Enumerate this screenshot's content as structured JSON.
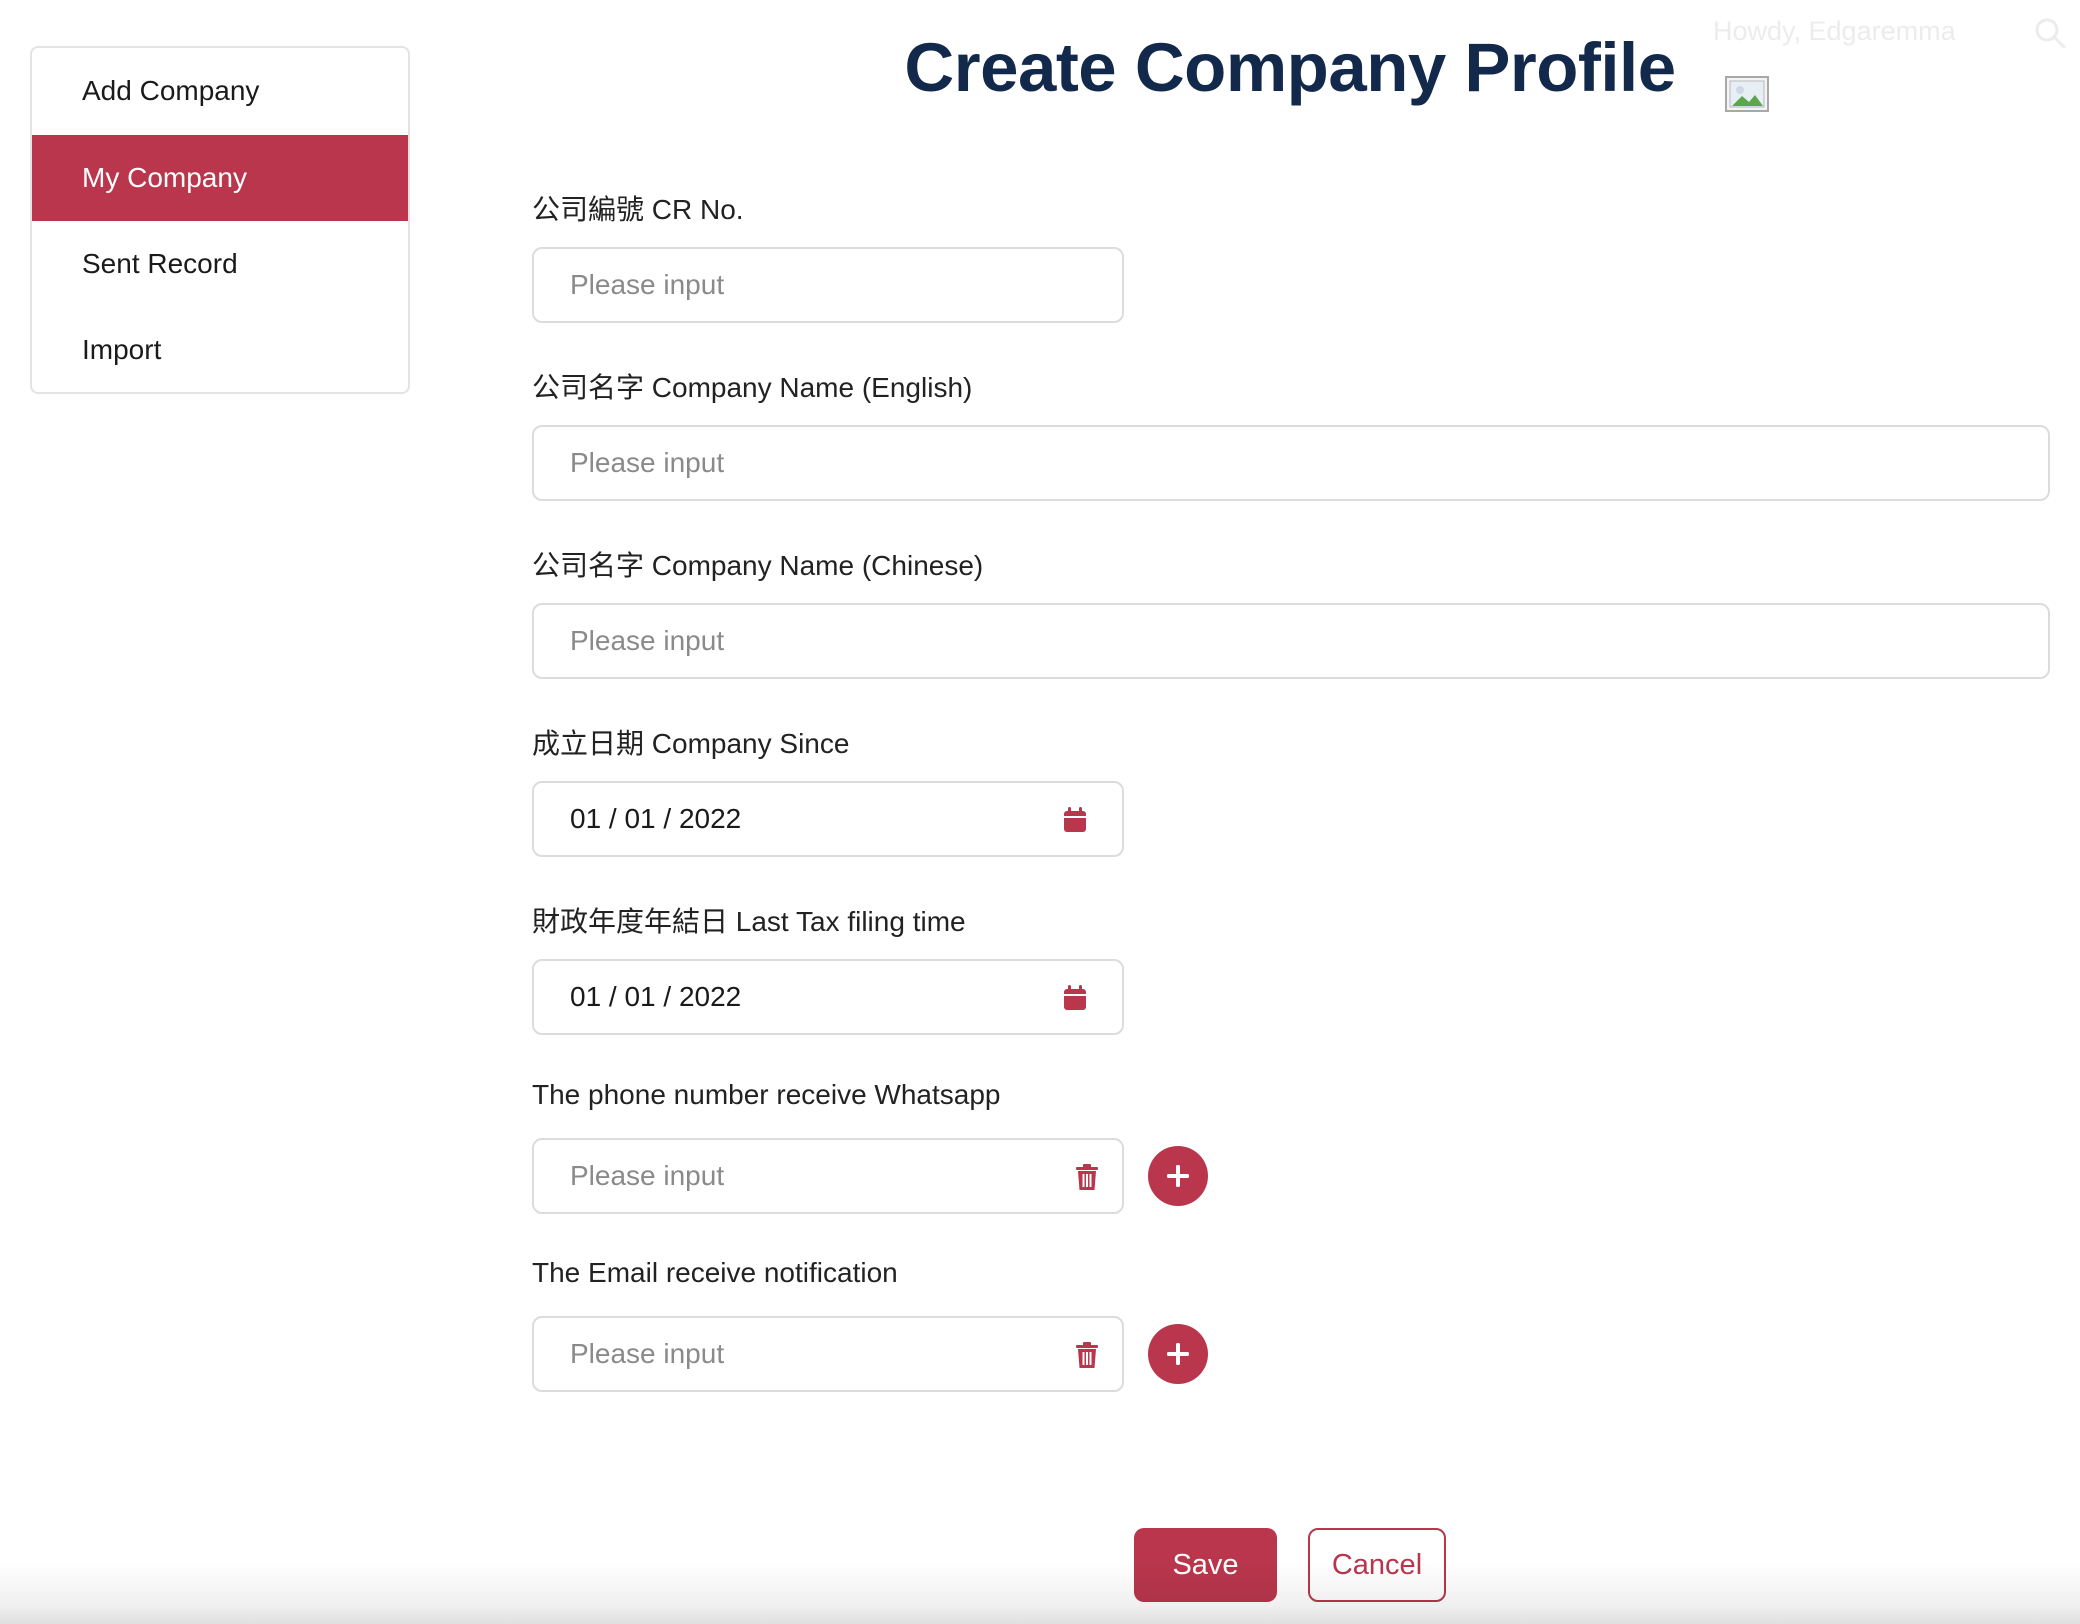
{
  "header": {
    "greeting": "Howdy, Edgaremma",
    "search_icon": "search-icon",
    "avatar_image": "broken-image-icon"
  },
  "sidebar": {
    "items": [
      {
        "label": "Add Company",
        "active": false
      },
      {
        "label": "My Company",
        "active": true
      },
      {
        "label": "Sent Record",
        "active": false
      },
      {
        "label": "Import",
        "active": false
      }
    ]
  },
  "page": {
    "title": "Create Company Profile"
  },
  "form": {
    "cr_no": {
      "label": "公司編號 CR No.",
      "placeholder": "Please input"
    },
    "name_en": {
      "label": "公司名字 Company Name (English)",
      "placeholder": "Please input"
    },
    "name_zh": {
      "label": "公司名字 Company Name (Chinese)",
      "placeholder": "Please input"
    },
    "since": {
      "label": "成立日期 Company Since",
      "value": "01 / 01 / 2022",
      "icon": "calendar-icon"
    },
    "tax": {
      "label": "財政年度年結日 Last Tax filing time",
      "value": "01 / 01 / 2022",
      "icon": "calendar-icon"
    },
    "phone": {
      "label": "The phone number receive Whatsapp",
      "placeholder": "Please input",
      "icon": "trash-icon"
    },
    "email": {
      "label": "The Email receive notification",
      "placeholder": "Please input",
      "icon": "trash-icon"
    }
  },
  "actions": {
    "save_label": "Save",
    "cancel_label": "Cancel"
  },
  "colors": {
    "accent": "#b9364c",
    "title": "#13294b",
    "border": "#dcdcdc"
  }
}
